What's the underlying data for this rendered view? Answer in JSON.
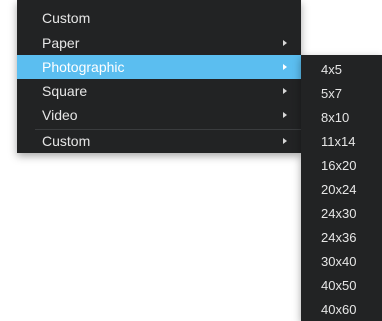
{
  "main_menu": {
    "items": [
      {
        "label": "Custom",
        "has_submenu": false,
        "selected": false
      },
      {
        "label": "Paper",
        "has_submenu": true,
        "selected": false
      },
      {
        "label": "Photographic",
        "has_submenu": true,
        "selected": true
      },
      {
        "label": "Square",
        "has_submenu": true,
        "selected": false
      },
      {
        "label": "Video",
        "has_submenu": true,
        "selected": false
      },
      {
        "label": "Custom",
        "has_submenu": true,
        "selected": false
      }
    ],
    "submenu_arrow_icon": "chevron-right-icon",
    "highlight_color": "#5bbef0",
    "background_color": "#222324"
  },
  "photographic_submenu": {
    "items": [
      "4x5",
      "5x7",
      "8x10",
      "11x14",
      "16x20",
      "20x24",
      "24x30",
      "24x36",
      "30x40",
      "40x50",
      "40x60"
    ]
  }
}
